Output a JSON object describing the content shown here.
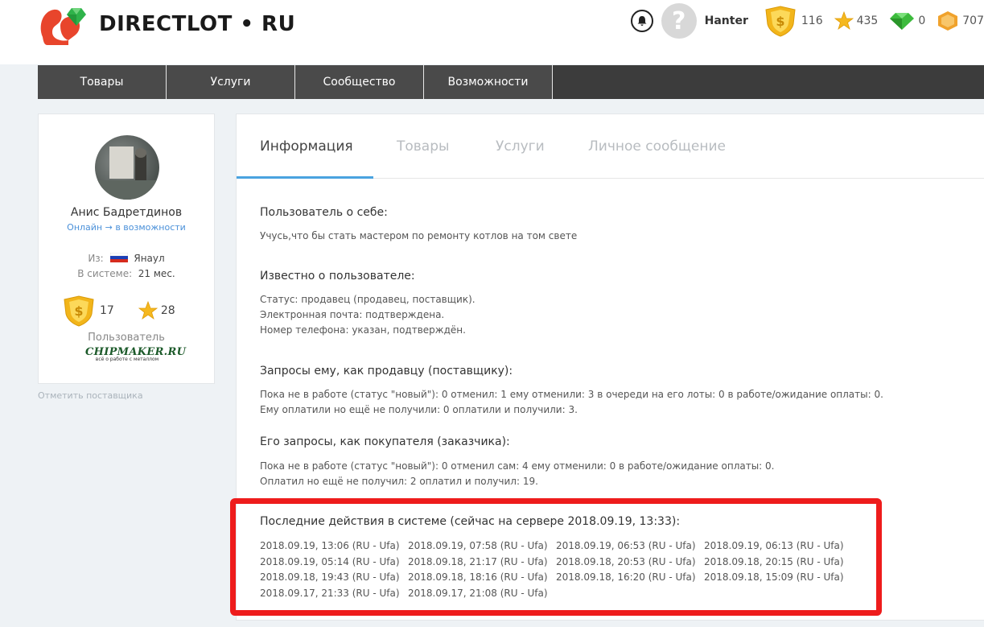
{
  "header": {
    "logo_text": "DIRECTLOT • RU",
    "username": "Hanter",
    "stats": [
      {
        "icon": "shield-dollar-icon",
        "value": "116",
        "color": "#f2b51a"
      },
      {
        "icon": "star-icon",
        "value": "435",
        "color": "#f5b81f"
      },
      {
        "icon": "green-gem-icon",
        "value": "0",
        "color": "#3dbb3d"
      },
      {
        "icon": "orange-gem-icon",
        "value": "707",
        "color": "#f0a22c"
      }
    ]
  },
  "nav": {
    "items": [
      "Товары",
      "Услуги",
      "Сообщество",
      "Возможности"
    ]
  },
  "profile": {
    "name": "Анис Бадретдинов",
    "status": "Онлайн → в возможности",
    "from_label": "Из:",
    "from_value": "Янаул",
    "since_label": "В системе:",
    "since_value": "21 мес.",
    "badge_value": "17",
    "star_value": "28",
    "role": "Пользователь",
    "chipmaker_title": "CHIPMAKER.RU",
    "chipmaker_sub": "всё о работе с металлом",
    "report_link": "Отметить поставщика"
  },
  "tabs": [
    "Информация",
    "Товары",
    "Услуги",
    "Личное сообщение"
  ],
  "sections": {
    "about_title": "Пользователь о себе:",
    "about_text": "Учусь,что бы стать мастером по ремонту котлов на том свете",
    "known_title": "Известно о пользователе:",
    "known_lines": [
      "Статус: продавец (продавец, поставщик).",
      "Электронная почта: подтверждена.",
      "Номер телефона: указан, подтверждён."
    ],
    "seller_title": "Запросы ему, как продавцу (поставщику):",
    "seller_lines": [
      "Пока не в работе (статус \"новый\"): 0   отменил: 1   ему отменили: 3   в очереди на его лоты: 0   в работе/ожидание оплаты: 0.",
      "Ему оплатили но ещё не получили: 0   оплатили и получили: 3."
    ],
    "buyer_title": "Его запросы, как покупателя (заказчика):",
    "buyer_lines": [
      "Пока не в работе (статус \"новый\"): 0   отменил сам: 4   ему отменили: 0   в работе/ожидание оплаты: 0.",
      "Оплатил но ещё не получил: 2   оплатил и получил: 19."
    ],
    "log_title": "Последние действия в системе (сейчас на сервере 2018.09.19, 13:33):",
    "log_entries": [
      "2018.09.19, 13:06 (RU - Ufa)",
      "2018.09.19, 07:58 (RU - Ufa)",
      "2018.09.19, 06:53 (RU - Ufa)",
      "2018.09.19, 06:13 (RU - Ufa)",
      "2018.09.19, 05:14 (RU - Ufa)",
      "2018.09.18, 21:17 (RU - Ufa)",
      "2018.09.18, 20:53 (RU - Ufa)",
      "2018.09.18, 20:15 (RU - Ufa)",
      "2018.09.18, 19:43 (RU - Ufa)",
      "2018.09.18, 18:16 (RU - Ufa)",
      "2018.09.18, 16:20 (RU - Ufa)",
      "2018.09.18, 15:09 (RU - Ufa)",
      "2018.09.17, 21:33 (RU - Ufa)",
      "2018.09.17, 21:08 (RU - Ufa)"
    ]
  },
  "colors": {
    "accent": "#4aa3df",
    "nav_bg": "#4a4a4a",
    "highlight": "#ee1c1c"
  }
}
